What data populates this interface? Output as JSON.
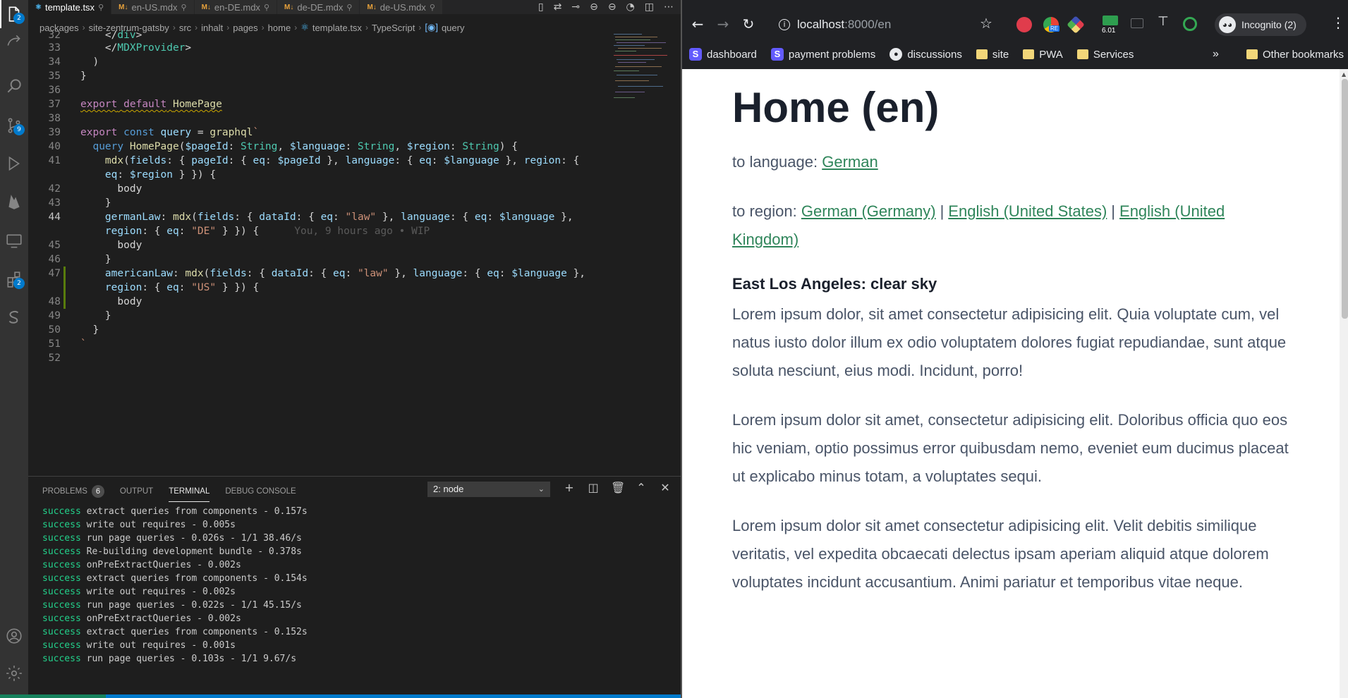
{
  "vscode": {
    "activity": {
      "explorer_badge": "2",
      "scm_badge": "9",
      "extensions_badge": "2"
    },
    "tabs": [
      {
        "icon": "⚛",
        "label": "template.tsx",
        "active": true
      },
      {
        "icon": "M↓",
        "label": "en-US.mdx",
        "active": false
      },
      {
        "icon": "M↓",
        "label": "en-DE.mdx",
        "active": false
      },
      {
        "icon": "M↓",
        "label": "de-DE.mdx",
        "active": false
      },
      {
        "icon": "M↓",
        "label": "de-US.mdx",
        "active": false
      }
    ],
    "breadcrumb": [
      "packages",
      "site-zentrum-gatsby",
      "src",
      "inhalt",
      "pages",
      "home",
      "template.tsx",
      "TypeScript",
      "query"
    ],
    "code": {
      "l32": "32",
      "l33": "33",
      "l34": "34",
      "l35": "35",
      "l36": "36",
      "l37": "37",
      "l38": "38",
      "l39": "39",
      "l40": "40",
      "l41": "41",
      "l42": "42",
      "l43": "43",
      "l44": "44",
      "l45": "45",
      "l46": "46",
      "l47": "47",
      "l48": "48",
      "l49": "49",
      "l50": "50",
      "l51": "51",
      "l52": "52",
      "ghost": "You, 9 hours ago • WIP"
    },
    "panel": {
      "problems": "PROBLEMS",
      "problems_count": "6",
      "output": "OUTPUT",
      "terminal": "TERMINAL",
      "debug": "DEBUG CONSOLE",
      "terminal_select": "2: node",
      "terminal_lines": [
        {
          "status": "success",
          "text": "extract queries from components - 0.157s"
        },
        {
          "status": "success",
          "text": "write out requires - 0.005s"
        },
        {
          "status": "success",
          "text": "run page queries - 0.026s - 1/1 38.46/s"
        },
        {
          "status": "success",
          "text": "Re-building development bundle - 0.378s"
        },
        {
          "status": "success",
          "text": "onPreExtractQueries - 0.002s"
        },
        {
          "status": "success",
          "text": "extract queries from components - 0.154s"
        },
        {
          "status": "success",
          "text": "write out requires - 0.002s"
        },
        {
          "status": "success",
          "text": "run page queries - 0.022s - 1/1 45.15/s"
        },
        {
          "status": "success",
          "text": "onPreExtractQueries - 0.002s"
        },
        {
          "status": "success",
          "text": "extract queries from components - 0.152s"
        },
        {
          "status": "success",
          "text": "write out requires - 0.001s"
        },
        {
          "status": "success",
          "text": "run page queries - 0.103s - 1/1 9.67/s"
        }
      ]
    },
    "colors": {
      "accent": "#007acc",
      "success": "#23d18b"
    }
  },
  "chrome": {
    "url_host": "localhost",
    "url_path": ":8000/en",
    "ext_badge_re": "RE",
    "ext_badge_num": "6.01",
    "profile": "Incognito (2)",
    "bookmarks": [
      {
        "icon": "S",
        "label": "dashboard"
      },
      {
        "icon": "S",
        "label": "payment problems"
      },
      {
        "icon": "github",
        "label": "discussions"
      },
      {
        "icon": "folder",
        "label": "site"
      },
      {
        "icon": "folder",
        "label": "PWA"
      },
      {
        "icon": "folder",
        "label": "Services"
      }
    ],
    "bookmarks_more": "»",
    "other_bookmarks": "Other bookmarks"
  },
  "page": {
    "title": "Home (en)",
    "to_language_label": "to language:",
    "to_language_link": "German",
    "to_region_label": "to region:",
    "region_links": [
      "German (Germany)",
      "English (United States)",
      "English (United Kingdom)"
    ],
    "weather": "East Los Angeles: clear sky",
    "paragraphs": [
      "Lorem ipsum dolor, sit amet consectetur adipisicing elit. Quia voluptate cum, vel natus iusto dolor illum ex odio voluptatem dolores fugiat repudiandae, sunt atque soluta nesciunt, eius modi. Incidunt, porro!",
      "Lorem ipsum dolor sit amet, consectetur adipisicing elit. Doloribus officia quo eos hic veniam, optio possimus error quibusdam nemo, eveniet eum ducimus placeat ut explicabo minus totam, a voluptates sequi.",
      "Lorem ipsum dolor sit amet consectetur adipisicing elit. Velit debitis similique veritatis, vel expedita obcaecati delectus ipsam aperiam aliquid atque dolorem voluptates incidunt accusantium. Animi pariatur et temporibus vitae neque."
    ],
    "link_color": "#2f855a"
  }
}
